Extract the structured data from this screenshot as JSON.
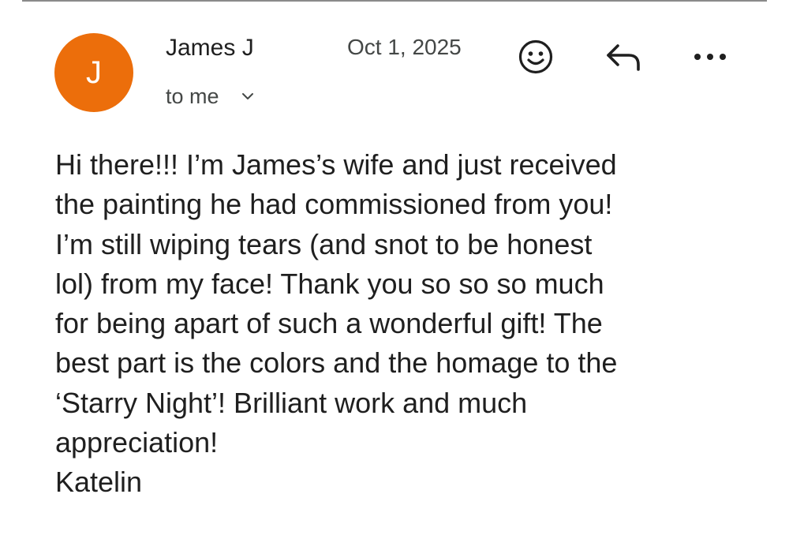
{
  "email": {
    "avatar_initial": "J",
    "sender_name": "James J",
    "date": "Oct 1, 2025",
    "recipient": "to me",
    "body_lines": [
      "Hi there!!! I’m James’s wife and just received",
      "the painting he had commissioned from you!",
      "I’m still wiping tears (and snot to be honest",
      "lol) from my face! Thank you so so so much",
      "for being apart of such a wonderful gift! The",
      "best part is the colors and the homage to the",
      "‘Starry Night’! Brilliant work and much",
      "appreciation!",
      "Katelin"
    ]
  },
  "actions": {
    "emoji_icon": "smiley-face-icon",
    "reply_icon": "reply-arrow-icon",
    "more_icon": "more-horizontal-icon",
    "recipient_toggle_icon": "chevron-down-icon"
  },
  "colors": {
    "avatar_background": "#ec6e0b",
    "avatar_text": "#ffffff",
    "primary_text": "#1f1f1f",
    "secondary_text": "#444746",
    "divider": "#8a8a8a"
  }
}
